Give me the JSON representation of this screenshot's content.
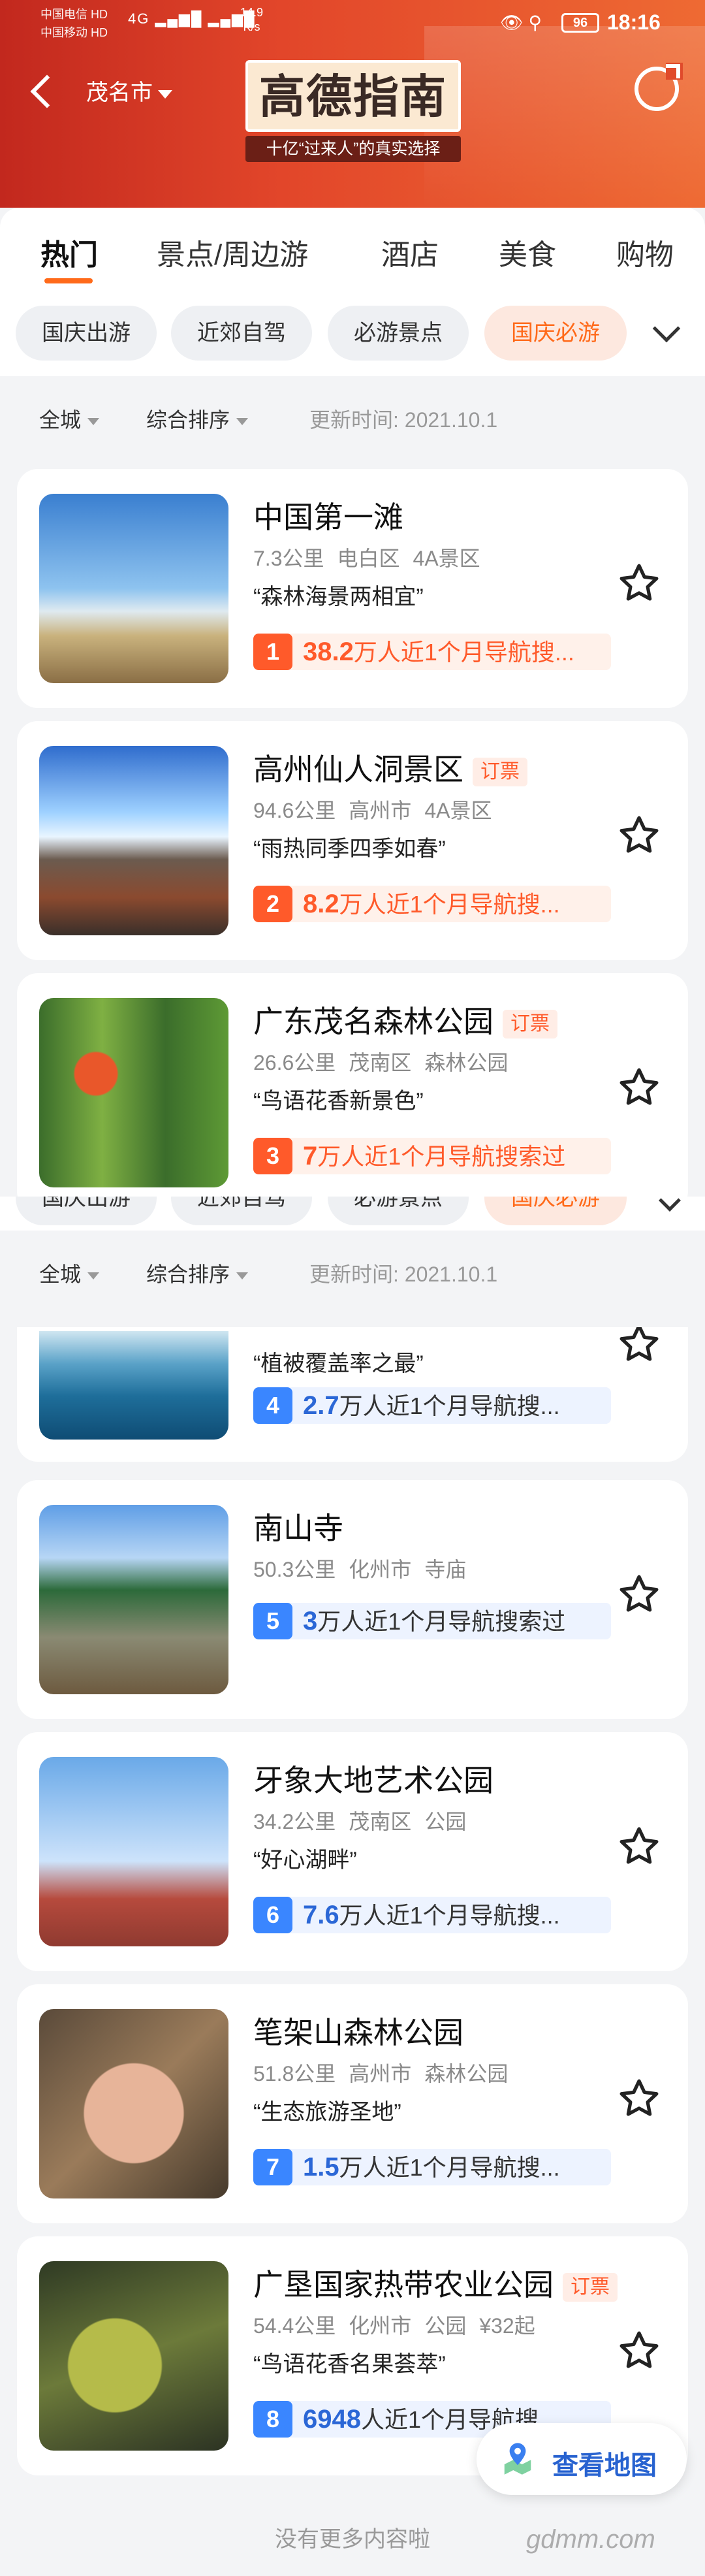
{
  "status": {
    "carrier_1": "中国电信 HD",
    "carrier_2": "中国移动 HD",
    "signal": "4G ▂▄▆█ ▂▄▆█",
    "speed": "14.9\nK/s",
    "battery": "96",
    "time": "18:16"
  },
  "header": {
    "city": "茂名市",
    "brand_logo": "高德指南",
    "brand_slogan": "十亿“过来人”的真实选择"
  },
  "tabs": [
    "热门",
    "景点/周边游",
    "酒店",
    "美食",
    "购物"
  ],
  "chips": [
    "国庆出游",
    "近郊自驾",
    "必游景点",
    "国庆必游"
  ],
  "filters": {
    "area": "全城",
    "sort": "综合排序",
    "updated": "更新时间:  2021.10.1"
  },
  "cards": [
    {
      "title": "中国第一滩",
      "ticket": "",
      "distance": "7.3公里",
      "district": "电白区",
      "category": "4A景区",
      "price": "",
      "quote": "“森林海景两相宜”",
      "rank": "1",
      "count": "38.2",
      "count_suffix": "万人近1个月导航搜..."
    },
    {
      "title": "高州仙人洞景区",
      "ticket": "订票",
      "distance": "94.6公里",
      "district": "高州市",
      "category": "4A景区",
      "price": "",
      "quote": "“雨热同季四季如春”",
      "rank": "2",
      "count": "8.2",
      "count_suffix": "万人近1个月导航搜..."
    },
    {
      "title": "广东茂名森林公园",
      "ticket": "订票",
      "distance": "26.6公里",
      "district": "茂南区",
      "category": "森林公园",
      "price": "",
      "quote": "“鸟语花香新景色”",
      "rank": "3",
      "count": "7",
      "count_suffix": "万人近1个月导航搜索过"
    },
    {
      "title": "",
      "ticket": "",
      "distance": "",
      "district": "",
      "category": "",
      "price": "",
      "quote": "“植被覆盖率之最”",
      "rank": "4",
      "count": "2.7",
      "count_suffix": "万人近1个月导航搜..."
    },
    {
      "title": "南山寺",
      "ticket": "",
      "distance": "50.3公里",
      "district": "化州市",
      "category": "寺庙",
      "price": "",
      "quote": "",
      "rank": "5",
      "count": "3",
      "count_suffix": "万人近1个月导航搜索过"
    },
    {
      "title": "牙象大地艺术公园",
      "ticket": "",
      "distance": "34.2公里",
      "district": "茂南区",
      "category": "公园",
      "price": "",
      "quote": "“好心湖畔”",
      "rank": "6",
      "count": "7.6",
      "count_suffix": "万人近1个月导航搜..."
    },
    {
      "title": "笔架山森林公园",
      "ticket": "",
      "distance": "51.8公里",
      "district": "高州市",
      "category": "森林公园",
      "price": "",
      "quote": "“生态旅游圣地”",
      "rank": "7",
      "count": "1.5",
      "count_suffix": "万人近1个月导航搜..."
    },
    {
      "title": "广垦国家热带农业公园",
      "ticket": "订票",
      "distance": "54.4公里",
      "district": "化州市",
      "category": "公园",
      "price": "¥32起",
      "quote": "“鸟语花香名果荟萃”",
      "rank": "8",
      "count": "6948",
      "count_suffix": "人近1个月导航搜..."
    }
  ],
  "map_button": "查看地图",
  "footer": "没有更多内容啦",
  "watermark": "gdmm.com",
  "colors": {
    "accent": "#ff6a1a",
    "rank_top": "#ff5a2a",
    "rank_other": "#3a86ff",
    "header": "#d63a24"
  }
}
